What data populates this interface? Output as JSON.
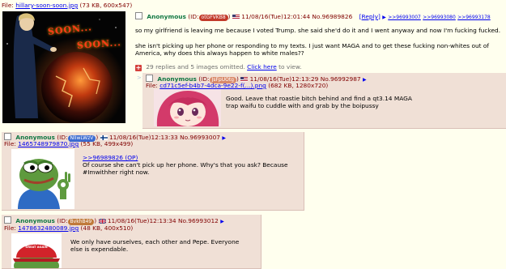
{
  "op": {
    "file_prefix": "File:",
    "file_name": "hillary-soon-soon.jpg",
    "file_meta": "(73 KB, 600x547)",
    "name": "Anonymous",
    "id_prefix": "(ID:",
    "id": "otGFVKB8",
    "id_suffix": ")",
    "date": "11/08/16(Tue)12:01:44",
    "post_no": "No.96989826",
    "reply_link": "Reply",
    "backlinks": [
      ">>96993007",
      ">>96993080",
      ">>96993178"
    ],
    "body": [
      "so my girlfriend is leaving me because I voted Trump. she said she'd do it and I went anyway and now I'm fucking fucked.",
      "she isn't picking up her phone or responding to my texts. I just want MAGA and to get these fucking non-whites out of America, why does this always happen to white males??"
    ],
    "omitted_text": "29 replies and 5 images omitted.",
    "omitted_link": "Click here",
    "omitted_suffix": "to view.",
    "image_caption_1": "SOON...",
    "image_caption_2": "SOON..."
  },
  "replies": [
    {
      "name": "Anonymous",
      "id": "JsFpUOtg",
      "date": "11/08/16(Tue)12:13:29",
      "post_no": "No.96992987",
      "file_name": "cd71c5ef-b4b7-4dca-9e22-f(...).png",
      "file_meta": "(682 KB, 1280x720)",
      "body": "Good. Leave that roastie bitch behind and find a qt3.14 MAGA trap waifu to cuddle with and grab by the boipussy"
    },
    {
      "name": "Anonymous",
      "id": "NlIwLWzV",
      "date": "11/08/16(Tue)12:13:33",
      "post_no": "No.96993007",
      "file_name": "1465748979870.jpg",
      "file_meta": "(55 KB, 499x499)",
      "quote_link": ">>96989826 (OP)",
      "body": "Of course she can't pick up her phone. Why's that you ask? Because #Imwithher right now."
    },
    {
      "name": "Anonymous",
      "id": "BvkhB49",
      "date": "11/08/16(Tue)12:13:34",
      "post_no": "No.96993012",
      "file_name": "1478632480089.jpg",
      "file_meta": "(48 KB, 400x510)",
      "body": "We only have ourselves, each other and Pepe. Everyone else is expendable.",
      "hat_text": "MAKE AMERICA GREAT AGAIN"
    }
  ],
  "ui": {
    "file_label": "File:",
    "id_prefix": "(ID:",
    "id_suffix": ")",
    "reply_open": "[",
    "reply_close": "]",
    "arrow": "▶",
    "side_marker": ">>",
    "expand_icon": "+"
  },
  "colors": {
    "page_bg": "#ffffee",
    "post_bg": "#f0e0d6",
    "name_green": "#117743",
    "quote_green": "#789922",
    "link_blue": "#0000ee"
  }
}
